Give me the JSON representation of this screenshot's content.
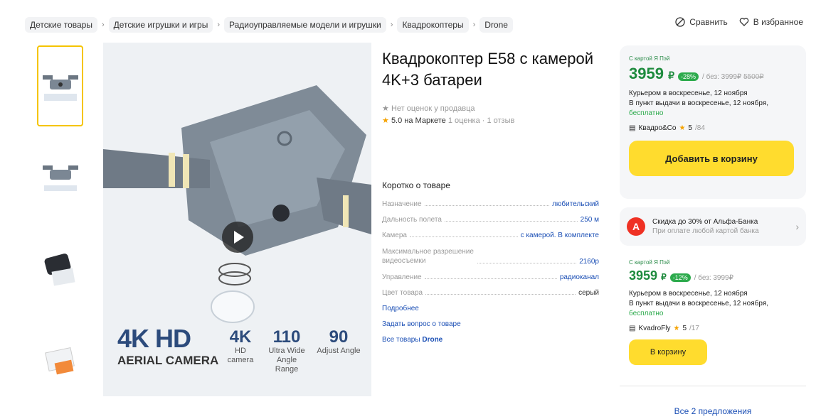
{
  "breadcrumbs": [
    "Детские товары",
    "Детские игрушки и игры",
    "Радиоуправляемые модели и игрушки",
    "Квадрокоптеры",
    "Drone"
  ],
  "actions": {
    "compare": "Сравнить",
    "favorites": "В избранное"
  },
  "product": {
    "title": "Квадрокоптер E58 с камерой 4K+3 батареи",
    "seller_rating": "Нет оценок у продавца",
    "market_rating": "5.0",
    "market_label": "на Маркете",
    "reviews": "1 оценка · 1 отзыв"
  },
  "image_promo": {
    "hd": "4K HD",
    "aerial": "AERIAL CAMERA",
    "features": [
      {
        "big": "4K",
        "small": "HD camera"
      },
      {
        "big": "110",
        "small": "Ultra Wide Angle Range"
      },
      {
        "big": "90",
        "small": "Adjust Angle"
      }
    ]
  },
  "specs": {
    "heading": "Коротко о товаре",
    "rows": [
      {
        "label": "Назначение",
        "value": "любительский"
      },
      {
        "label": "Дальность полета",
        "value": "250 м"
      },
      {
        "label": "Камера",
        "value": "с камерой. В комплекте"
      },
      {
        "label": "Максимальное разрешение видеосъемки",
        "value": "2160p"
      },
      {
        "label": "Управление",
        "value": "радиоканал"
      },
      {
        "label": "Цвет товара",
        "value": "серый"
      }
    ],
    "more": "Подробнее",
    "ask": "Задать вопрос о товаре",
    "all_prefix": "Все товары",
    "all_brand": "Drone"
  },
  "offer1": {
    "card_tag": "С картой Я Пэй",
    "price": "3959",
    "currency": "₽",
    "discount": "-28%",
    "without_card": "/ без: 3999₽",
    "old_price": "5500₽",
    "delivery_courier": "Курьером в воскресенье, 12 ноября",
    "delivery_pickup": "В пункт выдачи в воскресенье, 12 ноября,",
    "free": "бесплатно",
    "seller": "Квадро&Co",
    "seller_rating": "5",
    "seller_count": "/84",
    "cart_button": "Добавить в корзину"
  },
  "alfa": {
    "logo": "А",
    "title": "Скидка до 30% от Альфа-Банка",
    "subtitle": "При оплате любой картой банка"
  },
  "offer2": {
    "card_tag": "С картой Я Пэй",
    "price": "3959",
    "currency": "₽",
    "discount": "-12%",
    "without_card": "/ без: 3999₽",
    "delivery_courier": "Курьером в воскресенье, 12 ноября",
    "delivery_pickup": "В пункт выдачи в воскресенье, 12 ноября,",
    "free": "бесплатно",
    "seller": "KvadroFly",
    "seller_rating": "5",
    "seller_count": "/17",
    "cart_button": "В корзину"
  },
  "all_offers": "Все 2 предложения",
  "colors": {
    "accent_yellow": "#ffdc2e",
    "price_green": "#1e8b3e",
    "link_blue": "#1b4fb5",
    "alfa_red": "#ef3124"
  }
}
